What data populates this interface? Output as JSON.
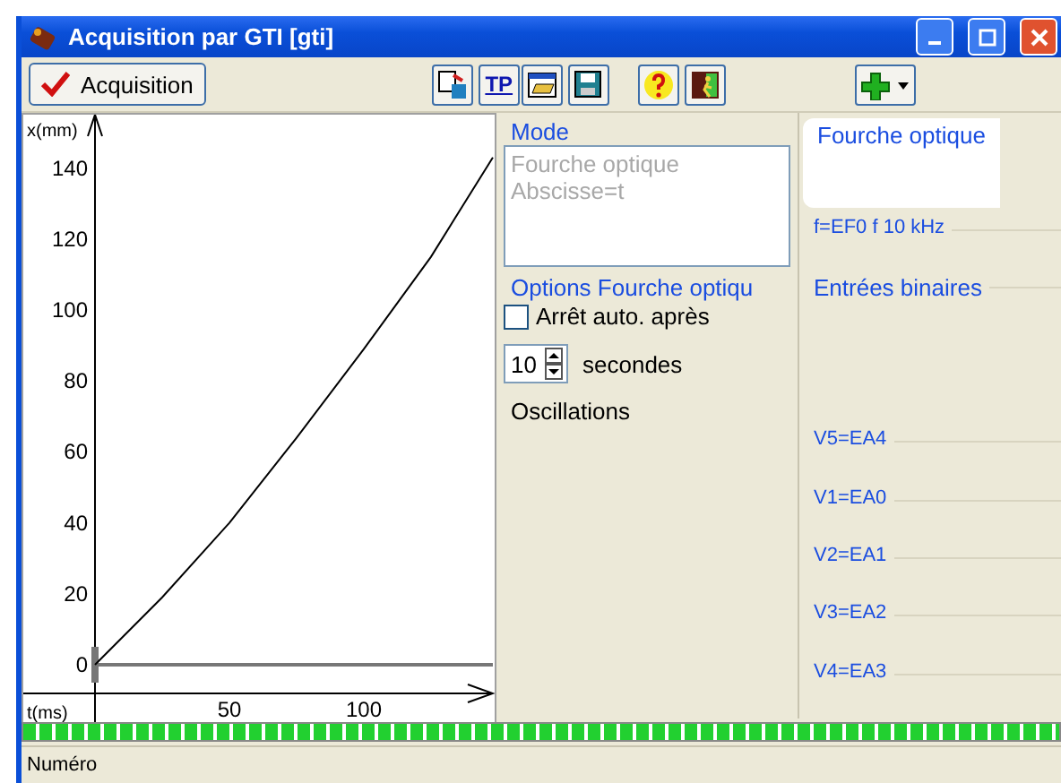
{
  "window": {
    "title": "Acquisition par GTI [gti]"
  },
  "toolbar": {
    "acquisition_button": "Acquisition",
    "tp_button": "TP"
  },
  "chart": {
    "chart_data": {
      "type": "line",
      "xlabel": "t(ms)",
      "ylabel": "x(mm)",
      "xlim": [
        -26.67,
        148.67
      ],
      "ylim": [
        -16.67,
        155.05
      ],
      "xticks": [
        50,
        100
      ],
      "yticks": [
        0,
        20,
        40,
        60,
        80,
        100,
        120,
        140
      ],
      "series": [
        {
          "color": "#000000",
          "x": [
            0,
            25,
            50,
            75,
            100,
            125,
            148
          ],
          "values": [
            0,
            19,
            40,
            64,
            89,
            115,
            143
          ]
        }
      ]
    }
  },
  "mode": {
    "title": "Mode",
    "lines": [
      "Fourche optique",
      "Abscisse=t"
    ]
  },
  "options": {
    "title": "Options Fourche optiqu",
    "auto_stop": {
      "label": "Arrêt auto. après",
      "checked": false
    },
    "duration": {
      "value": "10",
      "unit": "secondes"
    },
    "oscillations": "Oscillations"
  },
  "channels": [
    {
      "label": "Fourche optique",
      "kind": "header"
    },
    {
      "label": "f=EF0 f  10 kHz",
      "kind": "entry"
    },
    {
      "label": "Entrées binaires",
      "kind": "group"
    },
    {
      "label": "V5=EA4",
      "kind": "entry"
    },
    {
      "label": "V1=EA0",
      "kind": "entry"
    },
    {
      "label": "V2=EA1",
      "kind": "entry"
    },
    {
      "label": "V3=EA2",
      "kind": "entry"
    },
    {
      "label": "V4=EA3",
      "kind": "entry"
    }
  ],
  "progress": {
    "level": 1
  },
  "status_bar": "Numéro"
}
